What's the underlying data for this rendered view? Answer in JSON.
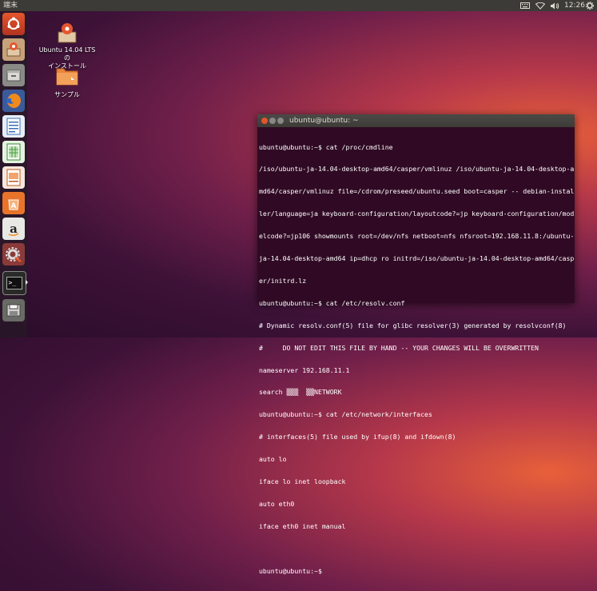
{
  "topbar": {
    "app_title": "端末",
    "clock": "12:26",
    "icons": [
      "keyboard-icon",
      "wifi-icon",
      "volume-icon",
      "gear-icon"
    ]
  },
  "launcher": {
    "items": [
      "ubuntu-dash-icon",
      "installer-icon",
      "files-icon",
      "firefox-icon",
      "writer-icon",
      "calc-icon",
      "impress-icon",
      "software-center-icon",
      "amazon-icon",
      "system-settings-icon",
      "terminal-icon",
      "drive-icon"
    ]
  },
  "desktop": {
    "installer": {
      "line1": "Ubuntu 14.04 LTS の",
      "line2": "インストール"
    },
    "sample": {
      "label": "サンプル"
    }
  },
  "terminal": {
    "title": "ubuntu@ubuntu: ~",
    "lines": [
      "ubuntu@ubuntu:~$ cat /proc/cmdline",
      "/iso/ubuntu-ja-14.04-desktop-amd64/casper/vmlinuz /iso/ubuntu-ja-14.04-desktop-a",
      "md64/casper/vmlinuz file=/cdrom/preseed/ubuntu.seed boot=casper -- debian-instal",
      "ler/language=ja keyboard-configuration/layoutcode?=jp keyboard-configuration/mod",
      "elcode?=jp106 showmounts root=/dev/nfs netboot=nfs nfsroot=192.168.11.8:/ubuntu-",
      "ja-14.04-desktop-amd64 ip=dhcp ro initrd=/iso/ubuntu-ja-14.04-desktop-amd64/casp",
      "er/initrd.lz",
      "ubuntu@ubuntu:~$ cat /etc/resolv.conf",
      "# Dynamic resolv.conf(5) file for glibc resolver(3) generated by resolvconf(8)",
      "#     DO NOT EDIT THIS FILE BY HAND -- YOUR CHANGES WILL BE OVERWRITTEN",
      "nameserver 192.168.11.1",
      "search ▒▒▒  ▒▒NETWORK",
      "ubuntu@ubuntu:~$ cat /etc/network/interfaces",
      "# interfaces(5) file used by ifup(8) and ifdown(8)",
      "auto lo",
      "iface lo inet loopback",
      "auto eth0",
      "iface eth0 inet manual",
      "",
      "ubuntu@ubuntu:~$ "
    ]
  }
}
